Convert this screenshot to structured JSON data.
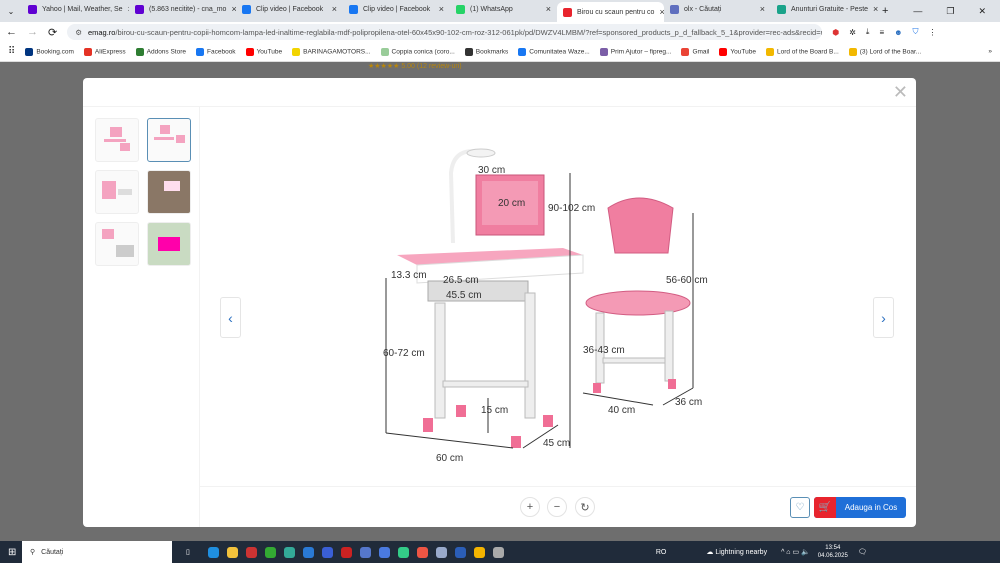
{
  "tabs": [
    {
      "title": "Yahoo | Mail, Weather, Se",
      "color": "#6001d2"
    },
    {
      "title": "(5.863 necitite) - cna_mo",
      "color": "#6001d2"
    },
    {
      "title": "Clip video | Facebook",
      "color": "#1877f2"
    },
    {
      "title": "Clip video | Facebook",
      "color": "#1877f2"
    },
    {
      "title": "(1) WhatsApp",
      "color": "#25d366"
    },
    {
      "title": "Birou cu scaun pentru co",
      "color": "#e8242d",
      "active": true
    },
    {
      "title": "olx - Căutați",
      "color": "#5f6fbf"
    },
    {
      "title": "Anunturi Gratuite - Peste",
      "color": "#1aa38a"
    }
  ],
  "address": {
    "domain": "emag.ro",
    "path": "/birou-cu-scaun-pentru-copii-homcom-lampa-led-inaltime-reglabila-mdf-polipropilena-otel-60x45x90-102-cm-roz-312-061pk/pd/DWZV4LMBM/?ref=sponsored_products_p_d_fallback_5_1&provider=rec-ads&recid=recads..."
  },
  "bookmarks": [
    {
      "label": "Booking.com",
      "color": "#003580"
    },
    {
      "label": "AliExpress",
      "color": "#e43225"
    },
    {
      "label": "Addons Store",
      "color": "#2e7d32"
    },
    {
      "label": "Facebook",
      "color": "#1877f2"
    },
    {
      "label": "YouTube",
      "color": "#ff0000"
    },
    {
      "label": "BARINAGAMOTORS...",
      "color": "#f2d400"
    },
    {
      "label": "Coppia conica (coro...",
      "color": "#9c9"
    },
    {
      "label": "Bookmarks",
      "color": "#333"
    },
    {
      "label": "Comunitatea Waze...",
      "color": "#1877f2"
    },
    {
      "label": "Prim Ajutor – fipreg...",
      "color": "#7b5ea7"
    },
    {
      "label": "Gmail",
      "color": "#ea4335"
    },
    {
      "label": "YouTube",
      "color": "#ff0000"
    },
    {
      "label": "Lord of the Board B...",
      "color": "#f2b800"
    },
    {
      "label": "(3) Lord of the Boar...",
      "color": "#f2b800"
    }
  ],
  "page": {
    "rating": "★★★★★ 5.00 (12 review-uri)"
  },
  "product_image": {
    "labels": {
      "width30": "30 cm",
      "h20": "20 cm",
      "height90": "90-102 cm",
      "d13": "13.3 cm",
      "d26": "26.5 cm",
      "d45": "45.5 cm",
      "h60": "60-72 cm",
      "h15": "15 cm",
      "w60": "60 cm",
      "d45b": "45 cm",
      "chair56": "56-60 cm",
      "chair36h": "36-43 cm",
      "chair40": "40 cm",
      "chair36": "36 cm"
    }
  },
  "controls": {
    "zoom_in": "+",
    "zoom_out": "−",
    "reset": "↻",
    "add_to_cart": "Adauga in Cos",
    "prev": "‹",
    "next": "›",
    "close": "✕"
  },
  "taskbar": {
    "search": "Căutați",
    "lang": "RO",
    "weather": "Lightning nearby",
    "time": "13:54",
    "date": "04.06.2025"
  }
}
